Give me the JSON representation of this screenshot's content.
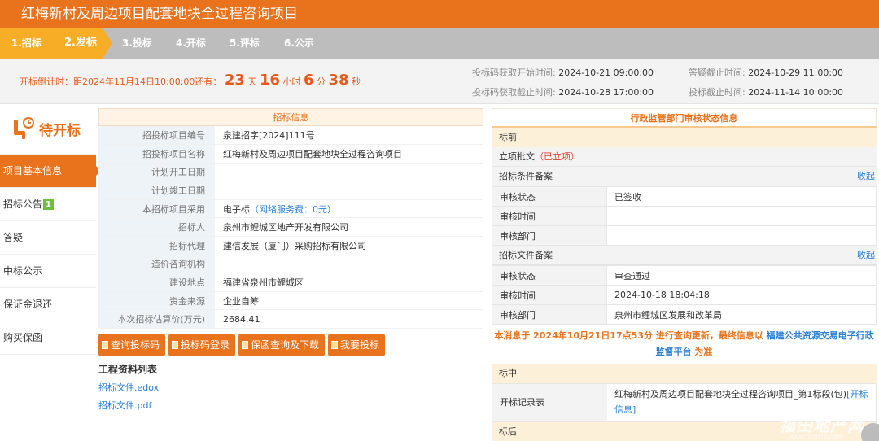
{
  "title": "红梅新村及周边项目配套地块全过程咨询项目",
  "steps": [
    "1.招标",
    "2.发标",
    "3.投标",
    "4.开标",
    "5.评标",
    "6.公示"
  ],
  "countdown": {
    "prefix": "开标倒计时：距2024年11月14日10:00:00还有：",
    "days": "23",
    "days_unit": "天",
    "hours": "16",
    "hours_unit": "小时",
    "minutes": "6",
    "minutes_unit": "分",
    "seconds": "38",
    "seconds_unit": "秒"
  },
  "times": {
    "code_start_label": "投标码获取开始时间:",
    "code_start": "2024-10-21 09:00:00",
    "code_end_label": "投标码获取截止时间:",
    "code_end": "2024-10-28 17:00:00",
    "qa_end_label": "答疑截止时间:",
    "qa_end": "2024-10-29 11:00:00",
    "bid_end_label": "投标截止时间:",
    "bid_end": "2024-11-14 10:00:00"
  },
  "status": "待开标",
  "nav": {
    "basic": "项目基本信息",
    "notice": "招标公告",
    "notice_badge": "1",
    "qa": "答疑",
    "win": "中标公示",
    "deposit": "保证金退还",
    "insurance": "购买保函"
  },
  "info": {
    "header": "招标信息",
    "rows": [
      {
        "k": "招投标项目编号",
        "v": "泉建招字[2024]111号"
      },
      {
        "k": "招投标项目名称",
        "v": "红梅新村及周边项目配套地块全过程咨询项目"
      },
      {
        "k": "计划开工日期",
        "v": ""
      },
      {
        "k": "计划竣工日期",
        "v": ""
      },
      {
        "k": "本招标项目采用",
        "v": "电子标",
        "v_extra": "（网络服务费：0元）"
      },
      {
        "k": "招标人",
        "v": "泉州市鲤城区地产开发有限公司"
      },
      {
        "k": "招标代理",
        "v": "建信发展（厦门）采购招标有限公司"
      },
      {
        "k": "造价咨询机构",
        "v": ""
      },
      {
        "k": "建设地点",
        "v": "福建省泉州市鲤城区"
      },
      {
        "k": "资金来源",
        "v": "企业自筹"
      },
      {
        "k": "本次招标估算价(万元)",
        "v": "2684.41"
      }
    ]
  },
  "buttons": {
    "query_code": "查询投标码",
    "code_login": "投标码登录",
    "guarantee": "保函查询及下载",
    "bid": "我要投标"
  },
  "files": {
    "title": "工程资料列表",
    "items": [
      "招标文件.edox",
      "招标文件.pdf"
    ]
  },
  "review": {
    "header": "行政监管部门审核状态信息",
    "before_label": "标前",
    "approval": "立项批文",
    "approval_status": "（已立项）",
    "cond_record": "招标条件备案",
    "collapse": "收起",
    "cond_rows": [
      {
        "k": "审核状态",
        "v": "已签收"
      },
      {
        "k": "审核时间",
        "v": ""
      },
      {
        "k": "审核部门",
        "v": ""
      }
    ],
    "doc_record": "招标文件备案",
    "doc_rows": [
      {
        "k": "审核状态",
        "v": "审查通过"
      },
      {
        "k": "审核时间",
        "v": "2024-10-18 18:04:18"
      },
      {
        "k": "审核部门",
        "v": "泉州市鲤城区发展和改革局"
      }
    ],
    "notice_pre": "本消息于 2024年10月21日17点53分 进行查询更新，最终信息以",
    "notice_link": "福建公共资源交易电子行政监督平台",
    "notice_post": "为准",
    "mid_label": "标中",
    "open_record_label": "开标记录表",
    "open_record_value": "红梅新村及周边项目配套地块全过程咨询项目_第1标段(包)",
    "open_record_link": "[开标信息]",
    "after_label": "标后"
  },
  "watermark": "福田地产网",
  "watermark_url": "www.nxdctz.com",
  "colors": {
    "accent": "#e8731c",
    "step_active": "#f7ad25",
    "link": "#2a7fd4",
    "badge": "#6cbf3c"
  }
}
